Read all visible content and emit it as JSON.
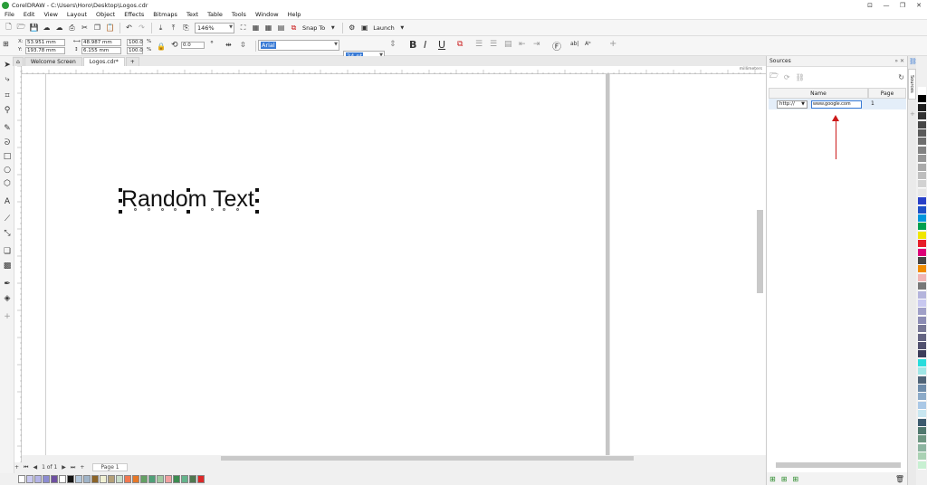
{
  "window": {
    "title": "CorelDRAW - C:\\Users\\Horo\\Desktop\\Logos.cdr",
    "controls": [
      "⊡",
      "—",
      "❐",
      "✕"
    ]
  },
  "menu": [
    "File",
    "Edit",
    "View",
    "Layout",
    "Object",
    "Effects",
    "Bitmaps",
    "Text",
    "Table",
    "Tools",
    "Window",
    "Help"
  ],
  "toolbar": {
    "zoom": "146%",
    "snap_to": "Snap To",
    "launch": "Launch"
  },
  "property_bar": {
    "x": "53.951 mm",
    "y": "193.78 mm",
    "width": "48.987 mm",
    "height": "6.155 mm",
    "scale_w": "100.0",
    "scale_h": "100.0",
    "percent": "%",
    "angle": "0.0",
    "font": "Arial",
    "font_size": "24 pt",
    "bold": "B",
    "italic": "I",
    "underline": "U"
  },
  "tabs": [
    "Welcome Screen",
    "Logos.cdr*"
  ],
  "canvas": {
    "text": "Random Text"
  },
  "ruler_units": "millimeters",
  "page_nav": {
    "counter": "1 of 1",
    "page_tab": "Page 1"
  },
  "docker": {
    "title": "Sources",
    "columns": [
      "Name",
      "Page"
    ],
    "row": {
      "protocol": "http://",
      "name": "www.google.com",
      "page": "1"
    },
    "vertical_tab": "Sources"
  },
  "colors": {
    "bottom_palette": [
      "#ffffff",
      "#c8c8f0",
      "#b4b4e6",
      "#8c8cd2",
      "#6e50a0",
      "#ffffff",
      "#141414",
      "#b4c8dc",
      "#a0b4c8",
      "#8c6428",
      "#f0f0d2",
      "#b4a078",
      "#c8dcc8",
      "#f07850",
      "#e67828",
      "#64a064",
      "#50a078",
      "#a0c8a0",
      "#f0a0a0",
      "#3c8c50",
      "#64b48c",
      "#507850",
      "#dc2828"
    ],
    "right_palette": [
      "#ffffff",
      "#000000",
      "#1e1e1e",
      "#323232",
      "#464646",
      "#5a5a5a",
      "#6e6e6e",
      "#828282",
      "#969696",
      "#aaaaaa",
      "#bebebe",
      "#d2d2d2",
      "#e6e6e6",
      "#2840c8",
      "#1e50c8",
      "#0096dc",
      "#00a050",
      "#f0e600",
      "#e61e28",
      "#dc0078",
      "#464646",
      "#f08c00",
      "#f0b4b4",
      "#787878",
      "#b4b4dc",
      "#c8c8f0",
      "#a0a0c8",
      "#8c8cb4",
      "#787896",
      "#646482",
      "#50506e",
      "#3c3c5a",
      "#28dcdc",
      "#a0e6e6",
      "#506478",
      "#6e8caa",
      "#8caac8",
      "#aac8e6",
      "#c8e6f0",
      "#3c5a6e",
      "#50786e",
      "#6e9682",
      "#8cb4a0",
      "#aad2b4",
      "#c8f0d2"
    ]
  }
}
